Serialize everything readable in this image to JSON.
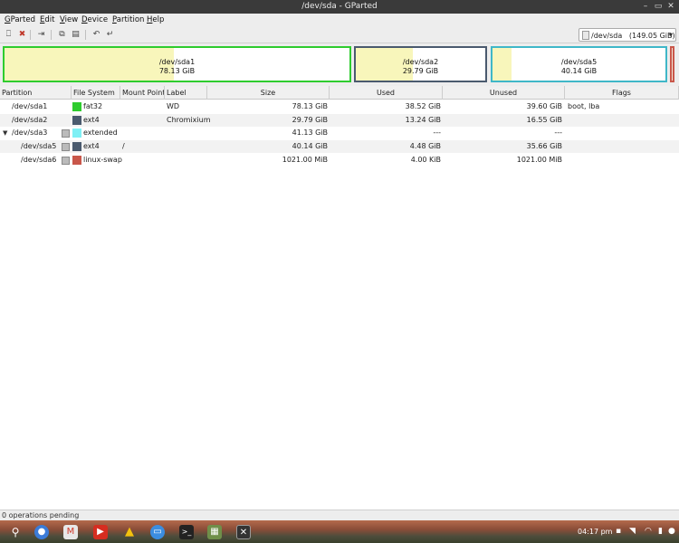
{
  "window": {
    "title": "/dev/sda - GParted"
  },
  "menu": [
    {
      "label": "GParted",
      "u": "G",
      "rest": "Parted"
    },
    {
      "label": "Edit",
      "u": "E",
      "rest": "dit"
    },
    {
      "label": "View",
      "u": "V",
      "rest": "iew"
    },
    {
      "label": "Device",
      "u": "D",
      "rest": "evice"
    },
    {
      "label": "Partition",
      "u": "P",
      "rest": "artition"
    },
    {
      "label": "Help",
      "u": "H",
      "rest": "elp"
    }
  ],
  "toolbar": {
    "icons": [
      "new-icon",
      "delete-icon",
      "resize-move-icon",
      "copy-icon",
      "paste-icon",
      "undo-icon",
      "apply-icon"
    ]
  },
  "device": {
    "name": "/dev/sda",
    "size": "(149.05 GiB)"
  },
  "diskmap": [
    {
      "name": "/dev/sda1",
      "size": "78.13 GiB",
      "used_fraction": 0.49,
      "border": "#2ecc2e"
    },
    {
      "name": "/dev/sda2",
      "size": "29.79 GiB",
      "used_fraction": 0.44,
      "border": "#4a5a6e"
    },
    {
      "name": "/dev/sda5",
      "size": "40.14 GiB",
      "used_fraction": 0.11,
      "border": "#3fb7c8"
    }
  ],
  "columns": [
    "Partition",
    "File System",
    "Mount Point",
    "Label",
    "Size",
    "Used",
    "Unused",
    "Flags"
  ],
  "rows": [
    {
      "partition": "/dev/sda1",
      "fs": "fat32",
      "fs_color": "#2ecc2e",
      "mount": "",
      "label": "WD",
      "size": "78.13 GiB",
      "used": "38.52 GiB",
      "unused": "39.60 GiB",
      "flags": "boot, lba",
      "indent": 0,
      "lock": false,
      "expander": ""
    },
    {
      "partition": "/dev/sda2",
      "fs": "ext4",
      "fs_color": "#4a5a6e",
      "mount": "",
      "label": "Chromixium",
      "size": "29.79 GiB",
      "used": "13.24 GiB",
      "unused": "16.55 GiB",
      "flags": "",
      "indent": 0,
      "lock": false,
      "expander": ""
    },
    {
      "partition": "/dev/sda3",
      "fs": "extended",
      "fs_color": "#7ff0f5",
      "mount": "",
      "label": "",
      "size": "41.13 GiB",
      "used": "---",
      "unused": "---",
      "flags": "",
      "indent": 0,
      "lock": true,
      "expander": "▼"
    },
    {
      "partition": "/dev/sda5",
      "fs": "ext4",
      "fs_color": "#4a5a6e",
      "mount": "/",
      "label": "",
      "size": "40.14 GiB",
      "used": "4.48 GiB",
      "unused": "35.66 GiB",
      "flags": "",
      "indent": 1,
      "lock": true,
      "expander": ""
    },
    {
      "partition": "/dev/sda6",
      "fs": "linux-swap",
      "fs_color": "#c9574a",
      "mount": "",
      "label": "",
      "size": "1021.00 MiB",
      "used": "4.00 KiB",
      "unused": "1021.00 MiB",
      "flags": "",
      "indent": 1,
      "lock": true,
      "expander": ""
    }
  ],
  "status": {
    "text": "0 operations pending"
  },
  "taskbar": {
    "time": "04:17 pm",
    "apps": [
      "search-icon",
      "chromium-icon",
      "gmail-icon",
      "youtube-icon",
      "drive-icon",
      "files-icon",
      "terminal-icon",
      "image-viewer-icon",
      "gparted-icon"
    ]
  }
}
